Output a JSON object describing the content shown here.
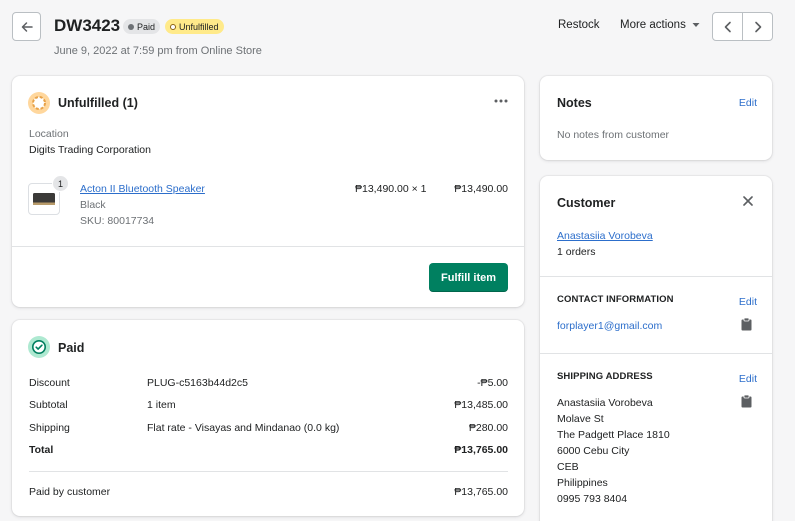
{
  "header": {
    "order_id": "DW3423",
    "badge_paid": "Paid",
    "badge_unfulfilled": "Unfulfilled",
    "subtitle": "June 9, 2022 at 7:59 pm from Online Store",
    "restock_label": "Restock",
    "more_actions_label": "More actions"
  },
  "fulfillment": {
    "title": "Unfulfilled (1)",
    "location_label": "Location",
    "location_value": "Digits Trading Corporation",
    "item": {
      "qty_badge": "1",
      "name": "Acton II Bluetooth Speaker",
      "variant": "Black",
      "sku": "SKU: 80017734",
      "unit_price": "₱13,490.00 × 1",
      "total": "₱13,490.00"
    },
    "fulfill_button": "Fulfill item"
  },
  "payment": {
    "title": "Paid",
    "rows": [
      {
        "label": "Discount",
        "detail": "PLUG-c5163b44d2c5",
        "amount": "-₱5.00"
      },
      {
        "label": "Subtotal",
        "detail": "1 item",
        "amount": "₱13,485.00"
      },
      {
        "label": "Shipping",
        "detail": "Flat rate - Visayas and Mindanao (0.0 kg)",
        "amount": "₱280.00"
      },
      {
        "label": "Total",
        "detail": "",
        "amount": "₱13,765.00"
      }
    ],
    "paid_by_label": "Paid by customer",
    "paid_by_amount": "₱13,765.00"
  },
  "notes": {
    "title": "Notes",
    "edit_label": "Edit",
    "body": "No notes from customer"
  },
  "customer": {
    "title": "Customer",
    "name": "Anastasiia Vorobeva",
    "orders": "1 orders",
    "contact_heading": "CONTACT INFORMATION",
    "contact_edit": "Edit",
    "email": "forplayer1@gmail.com",
    "shipping_heading": "SHIPPING ADDRESS",
    "shipping_edit": "Edit",
    "address_lines": [
      "Anastasiia Vorobeva",
      "Molave St",
      "The Padgett Place 1810",
      "6000 Cebu City",
      "CEB",
      "Philippines",
      "0995 793 8404"
    ]
  },
  "colors": {
    "primary_button": "#008060",
    "paid_badge_bg": "#e4e5e7",
    "unfulfilled_badge_bg": "#ffea8a",
    "unfulfilled_icon": "#e7a24a",
    "paid_icon": "#008060",
    "link": "#2c6ecb"
  },
  "icons": {
    "back": "arrow-left-icon",
    "prev": "chevron-left-icon",
    "next": "chevron-right-icon",
    "more": "horizontal-dots-icon",
    "close": "close-icon",
    "copy": "clipboard-icon"
  }
}
